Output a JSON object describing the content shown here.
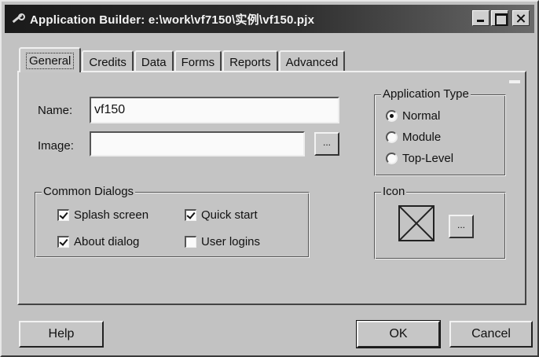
{
  "window": {
    "title": "Application Builder: e:\\work\\vf7150\\实例\\vf150.pjx"
  },
  "tabs": [
    {
      "label": "General",
      "active": true
    },
    {
      "label": "Credits",
      "active": false
    },
    {
      "label": "Data",
      "active": false
    },
    {
      "label": "Forms",
      "active": false
    },
    {
      "label": "Reports",
      "active": false
    },
    {
      "label": "Advanced",
      "active": false
    }
  ],
  "general": {
    "name_label": "Name:",
    "name_value": "vf150",
    "image_label": "Image:",
    "image_value": "",
    "browse_label": "..."
  },
  "app_type": {
    "title": "Application Type",
    "options": [
      {
        "label": "Normal",
        "selected": true
      },
      {
        "label": "Module",
        "selected": false
      },
      {
        "label": "Top-Level",
        "selected": false
      }
    ]
  },
  "dialogs": {
    "title": "Common Dialogs",
    "items": [
      {
        "label": "Splash screen",
        "checked": true
      },
      {
        "label": "Quick start",
        "checked": true
      },
      {
        "label": "About dialog",
        "checked": true
      },
      {
        "label": "User logins",
        "checked": false
      }
    ]
  },
  "icon": {
    "title": "Icon",
    "browse_label": "..."
  },
  "buttons": {
    "help": "Help",
    "ok": "OK",
    "cancel": "Cancel"
  }
}
